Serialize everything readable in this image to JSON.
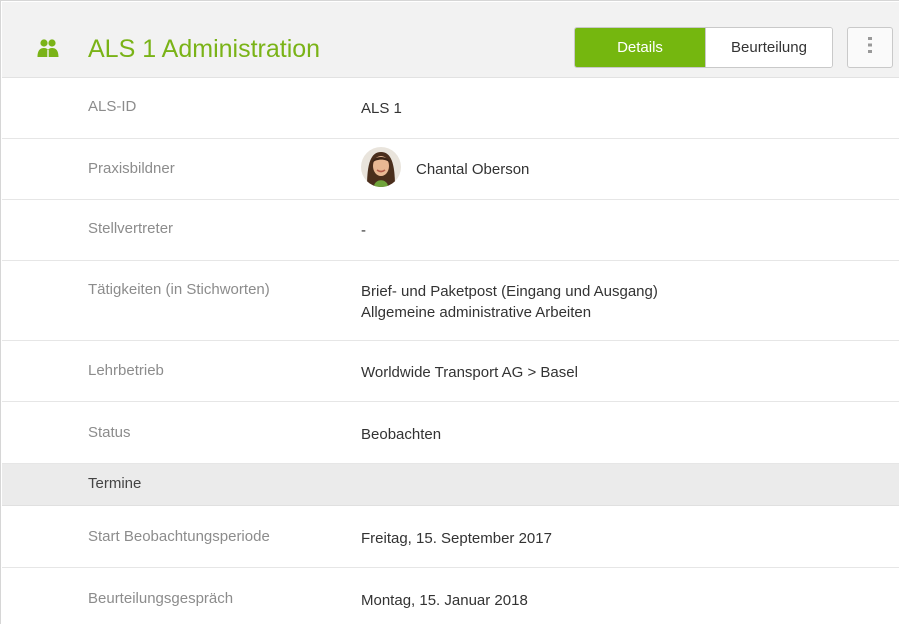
{
  "header": {
    "title": "ALS 1 Administration",
    "icon": "users-icon",
    "accent_color": "#7ab317",
    "tabs": [
      {
        "label": "Details",
        "active": true
      },
      {
        "label": "Beurteilung",
        "active": false
      }
    ],
    "more_icon": "vertical-ellipsis-icon"
  },
  "fields": {
    "als_id": {
      "label": "ALS-ID",
      "value": "ALS 1"
    },
    "praxisbildner": {
      "label": "Praxisbildner",
      "value": "Chantal Oberson"
    },
    "stellvertreter": {
      "label": "Stellvertreter",
      "value": "-"
    },
    "taetigkeiten": {
      "label": "Tätigkeiten (in Stichworten)",
      "lines": [
        "Brief- und Paketpost (Eingang und Ausgang)",
        "Allgemeine administrative Arbeiten"
      ]
    },
    "lehrbetrieb": {
      "label": "Lehrbetrieb",
      "value": "Worldwide Transport AG > Basel"
    },
    "status": {
      "label": "Status",
      "value": "Beobachten"
    }
  },
  "termine": {
    "section_label": "Termine",
    "start": {
      "label": "Start Beobachtungsperiode",
      "value": "Freitag, 15. September 2017"
    },
    "gespraech": {
      "label": "Beurteilungsgespräch",
      "value": "Montag, 15. Januar 2018"
    }
  }
}
